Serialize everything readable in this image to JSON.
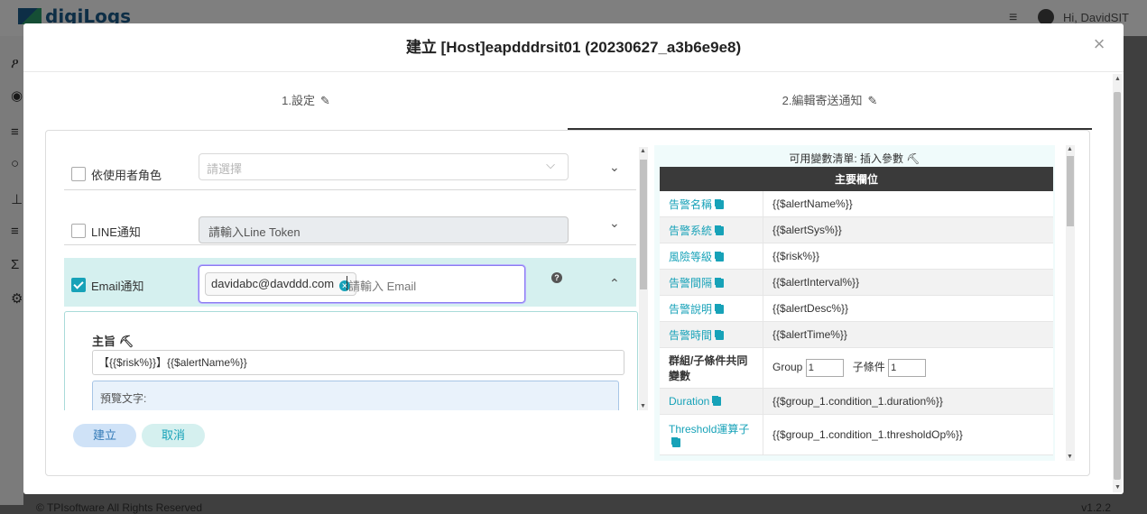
{
  "app": {
    "logo": "digiLogs",
    "greeting": "Hi, DavidSIT",
    "footer": "© TPIsoftware All Rights Reserved",
    "version": "v1.2.2"
  },
  "modal": {
    "title": "建立 [Host]eapdddrsit01 (20230627_a3b6e9e8)",
    "close": "×",
    "steps": [
      {
        "label": "1.設定",
        "active": false
      },
      {
        "label": "2.編輯寄送通知",
        "active": true
      }
    ]
  },
  "notify": {
    "role": {
      "label": "依使用者角色",
      "placeholder": "請選擇",
      "checked": false
    },
    "line": {
      "label": "LINE通知",
      "placeholder": "請輸入Line Token",
      "checked": false
    },
    "email": {
      "label": "Email通知",
      "checked": true,
      "tags": [
        "davidabc@davddd.com"
      ],
      "placeholder": "請輸入 Email"
    },
    "subject_label": "主旨",
    "subject_value": "【{{$risk%}}】{{$alertName%}}",
    "preview_label": "預覽文字:"
  },
  "buttons": {
    "create": "建立",
    "cancel": "取消"
  },
  "variables": {
    "title": "可用變數清單:  插入參數",
    "header": "主要欄位",
    "rows": [
      {
        "key": "告警名稱",
        "value": "{{$alertName%}}"
      },
      {
        "key": "告警系統",
        "value": "{{$alertSys%}}"
      },
      {
        "key": "風險等級",
        "value": "{{$risk%}}"
      },
      {
        "key": "告警間隔",
        "value": "{{$alertInterval%}}"
      },
      {
        "key": "告警說明",
        "value": "{{$alertDesc%}}"
      },
      {
        "key": "告警時間",
        "value": "{{$alertTime%}}"
      }
    ],
    "group_row": {
      "key": "群組/子條件共同變數",
      "group_label": "Group",
      "group_value": "1",
      "cond_label": "子條件",
      "cond_value": "1"
    },
    "rows2": [
      {
        "key": "Duration",
        "value": "{{$group_1.condition_1.duration%}}"
      },
      {
        "key": "Threshold運算子",
        "value": "{{$group_1.condition_1.thresholdOp%}}"
      }
    ]
  },
  "colors": {
    "accent": "#17a2b8",
    "highlight_row": "#d5f0ef"
  }
}
